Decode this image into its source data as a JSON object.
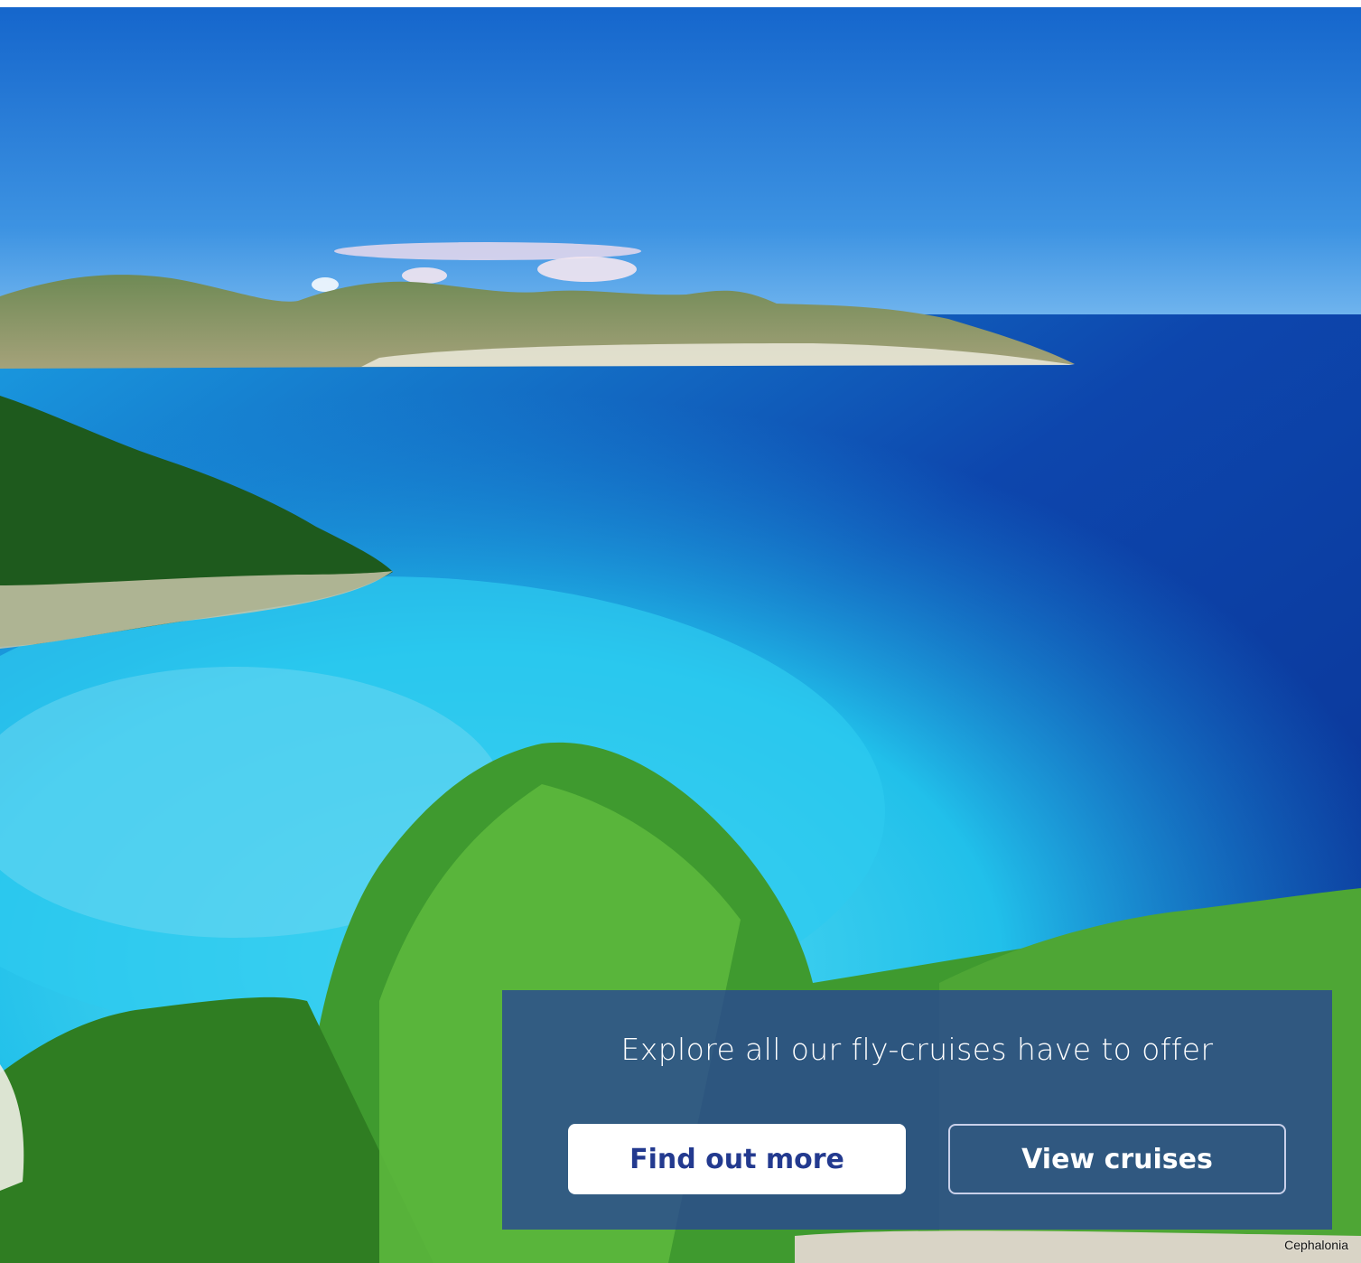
{
  "overlay": {
    "title": "Explore all our fly-cruises have to offer",
    "primary_button": "Find out more",
    "secondary_button": "View cruises"
  },
  "image_caption": "Cephalonia",
  "colors": {
    "overlay_bg": "#28429a",
    "button_text": "#233a8f",
    "sea_deep": "#0b3fa6",
    "sea_turquoise": "#25c4ea"
  }
}
